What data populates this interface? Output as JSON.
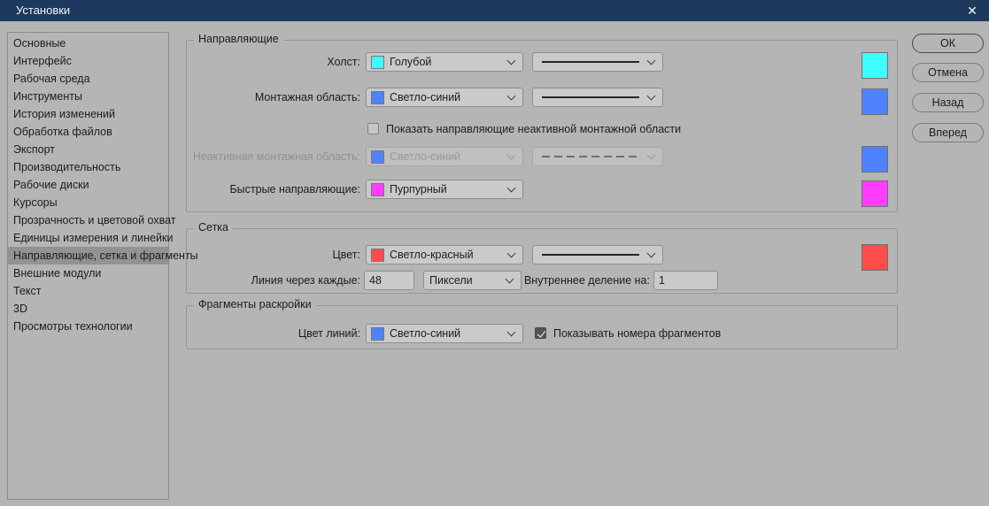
{
  "window": {
    "title": "Установки",
    "close_icon": "✕"
  },
  "sidebar": {
    "items": [
      {
        "label": "Основные",
        "selected": false
      },
      {
        "label": "Интерфейс",
        "selected": false
      },
      {
        "label": "Рабочая среда",
        "selected": false
      },
      {
        "label": "Инструменты",
        "selected": false
      },
      {
        "label": "История изменений",
        "selected": false
      },
      {
        "label": "Обработка файлов",
        "selected": false
      },
      {
        "label": "Экспорт",
        "selected": false
      },
      {
        "label": "Производительность",
        "selected": false
      },
      {
        "label": "Рабочие диски",
        "selected": false
      },
      {
        "label": "Курсоры",
        "selected": false
      },
      {
        "label": "Прозрачность и цветовой охват",
        "selected": false
      },
      {
        "label": "Единицы измерения и линейки",
        "selected": false
      },
      {
        "label": "Направляющие, сетка и фрагменты",
        "selected": true
      },
      {
        "label": "Внешние модули",
        "selected": false
      },
      {
        "label": "Текст",
        "selected": false
      },
      {
        "label": "3D",
        "selected": false
      },
      {
        "label": "Просмотры технологии",
        "selected": false
      }
    ]
  },
  "guides": {
    "title": "Направляющие",
    "canvas_label": "Холст:",
    "canvas_value": "Голубой",
    "artboard_label": "Монтажная область:",
    "artboard_value": "Светло-синий",
    "show_inactive_label": "Показать направляющие неактивной монтажной области",
    "show_inactive_checked": false,
    "inactive_label": "Неактивная монтажная область:",
    "inactive_value": "Светло-синий",
    "inactive_disabled": true,
    "smart_label": "Быстрые направляющие:",
    "smart_value": "Пурпурный"
  },
  "grid": {
    "title": "Сетка",
    "color_label": "Цвет:",
    "color_value": "Светло-красный",
    "spacing_label": "Линия через каждые:",
    "spacing_value": "48",
    "unit_value": "Пиксели",
    "subdivision_label": "Внутреннее деление на:",
    "subdivision_value": "1"
  },
  "slices": {
    "title": "Фрагменты раскройки",
    "line_color_label": "Цвет линий:",
    "line_color_value": "Светло-синий",
    "show_numbers_label": "Показывать номера фрагментов",
    "show_numbers_checked": true
  },
  "buttons": {
    "ok": "ОК",
    "cancel": "Отмена",
    "back": "Назад",
    "forward": "Вперед"
  },
  "colors": {
    "titlebar": "#1d3a5e",
    "cyan": "#3cfeff",
    "light_blue": "#4f82fe",
    "magenta": "#ff3dfe",
    "light_red": "#ff4d4b"
  }
}
